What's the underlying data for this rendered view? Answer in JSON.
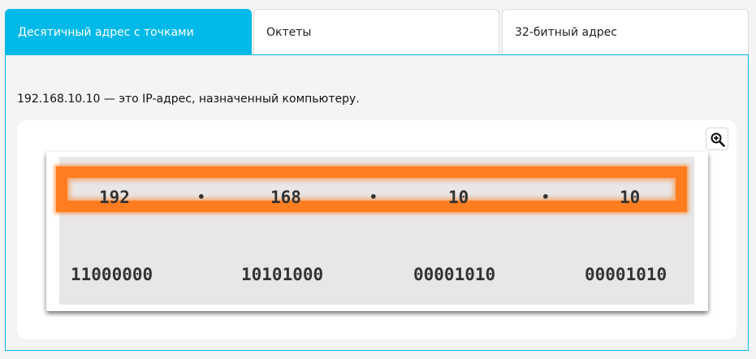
{
  "tabs": [
    {
      "label": "Десятичный адрес с точками",
      "active": true
    },
    {
      "label": "Октеты",
      "active": false
    },
    {
      "label": "32-битный адрес",
      "active": false
    }
  ],
  "description": "192.168.10.10 — это IP-адрес, назначенный компьютеру.",
  "zoom_button": {
    "icon": "zoom-in-icon"
  },
  "diagram": {
    "decimal_octets": [
      "192",
      "168",
      "10",
      "10"
    ],
    "separator": "•",
    "binary_octets": [
      "11000000",
      "10101000",
      "00001010",
      "00001010"
    ],
    "highlighted_row": "decimal"
  },
  "colors": {
    "active_tab": "#00b9e8",
    "highlight": "#ff7d1f",
    "diagram_background": "#e8e6e6"
  }
}
